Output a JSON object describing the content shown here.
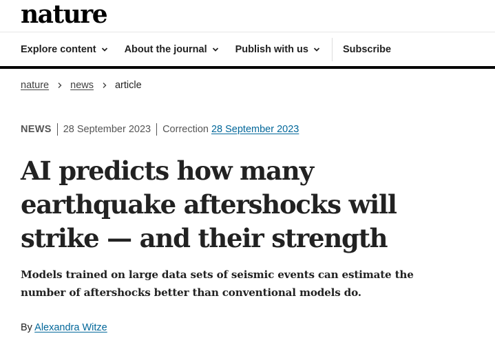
{
  "brand": {
    "logo_text": "nature"
  },
  "nav": {
    "items": [
      {
        "label": "Explore content",
        "has_dropdown": true
      },
      {
        "label": "About the journal",
        "has_dropdown": true
      },
      {
        "label": "Publish with us",
        "has_dropdown": true
      },
      {
        "label": "Subscribe",
        "has_dropdown": false
      }
    ],
    "dropdown_icon": "chevron-down-icon"
  },
  "breadcrumb": {
    "items": [
      "nature",
      "news",
      "article"
    ],
    "separator_icon": "chevron-right-icon"
  },
  "article": {
    "type": "NEWS",
    "published": "28 September 2023",
    "correction_label": "Correction",
    "correction_date": "28 September 2023",
    "title": "AI predicts how many earthquake aftershocks will strike — and their strength",
    "standfirst": "Models trained on large data sets of seismic events can estimate the number of aftershocks better than conventional models do.",
    "byline_prefix": "By",
    "author": "Alexandra Witze"
  },
  "colors": {
    "text": "#222222",
    "link": "#006699",
    "muted": "#555555",
    "rule": "#000000"
  }
}
